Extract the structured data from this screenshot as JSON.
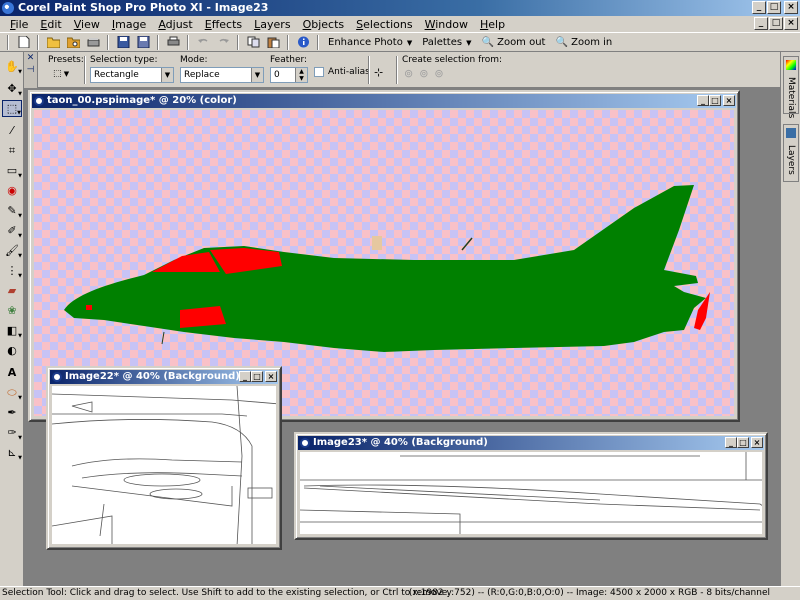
{
  "window": {
    "title": "Corel Paint Shop Pro Photo XI - Image23"
  },
  "menu": [
    "File",
    "Edit",
    "View",
    "Image",
    "Adjust",
    "Effects",
    "Layers",
    "Objects",
    "Selections",
    "Window",
    "Help"
  ],
  "toolbar": {
    "enhance_photo": "Enhance Photo",
    "palettes": "Palettes",
    "zoom_out": "Zoom out",
    "zoom_in": "Zoom in"
  },
  "tool_options": {
    "presets_label": "Presets:",
    "selection_type_label": "Selection type:",
    "selection_type_value": "Rectangle",
    "mode_label": "Mode:",
    "mode_value": "Replace",
    "feather_label": "Feather:",
    "feather_value": "0",
    "antialias_label": "Anti-alias",
    "create_from_label": "Create selection from:"
  },
  "right_palettes": [
    "Materials",
    "Layers"
  ],
  "documents": {
    "main": {
      "title": "taon_00.pspimage* @ 20% (color)"
    },
    "image22": {
      "title": "Image22* @ 40% (Background)"
    },
    "image23": {
      "title": "Image23* @ 40% (Background)"
    }
  },
  "status": {
    "hint": "Selection Tool: Click and drag to select. Use Shift to add to the existing selection, or Ctrl to remove.",
    "info": "(x:1982 y:752) -- (R:0,G:0,B:0,O:0) -- Image:  4500 x 2000 x RGB - 8 bits/channel"
  },
  "colors": {
    "title_blue": "#0a246a",
    "chrome": "#d4d0c8",
    "aircraft_green": "#008000",
    "aircraft_red": "#ff0000",
    "checker_pink": "#f9c1c8",
    "checker_lavender": "#c7c3f5"
  }
}
